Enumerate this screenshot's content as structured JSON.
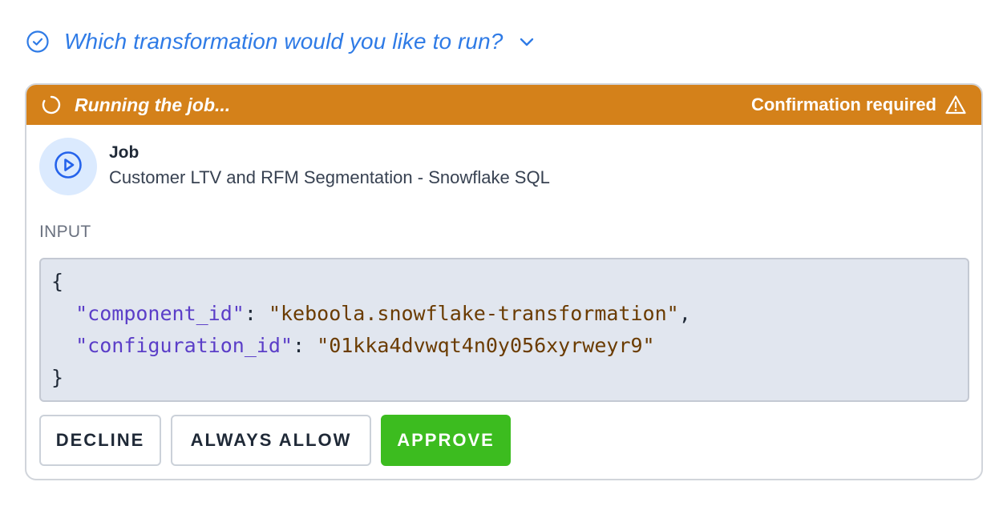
{
  "question": {
    "text": "Which transformation would you like to run?"
  },
  "card": {
    "status_text": "Running the job...",
    "confirmation_text": "Confirmation required",
    "header_color": "#d4811a",
    "job": {
      "title": "Job",
      "name": "Customer LTV and RFM Segmentation - Snowflake SQL"
    },
    "input_label": "INPUT",
    "input_json": {
      "open_brace": "{",
      "close_brace": "}",
      "entries": [
        {
          "key": "\"component_id\"",
          "value": "\"keboola.snowflake-transformation\"",
          "trailing": ","
        },
        {
          "key": "\"configuration_id\"",
          "value": "\"01kka4dvwqt4n0y056xyrweyr9\"",
          "trailing": ""
        }
      ]
    },
    "buttons": {
      "decline": "DECLINE",
      "always_allow": "ALWAYS ALLOW",
      "approve": "APPROVE"
    }
  },
  "icons": {
    "question": "check-circle-icon",
    "chevron": "chevron-down-icon",
    "status": "spinner-icon",
    "warning": "warning-triangle-icon",
    "job": "play-circle-icon"
  },
  "colors": {
    "accent_blue": "#2f7be6",
    "approve_green": "#3cbc1f"
  }
}
